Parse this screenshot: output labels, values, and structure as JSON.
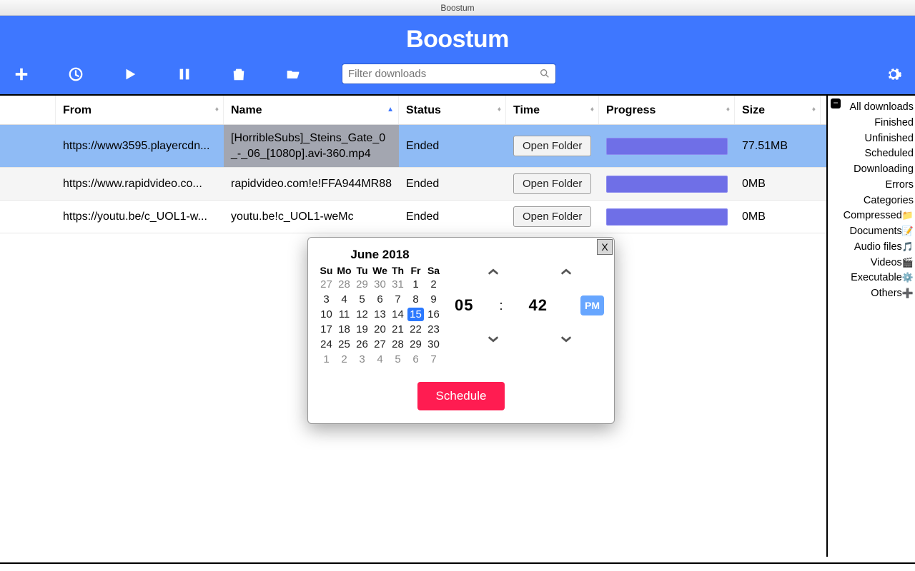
{
  "window_title": "Boostum",
  "app_title": "Boostum",
  "search": {
    "placeholder": "Filter downloads"
  },
  "columns": {
    "from": "From",
    "name": "Name",
    "status": "Status",
    "time": "Time",
    "progress": "Progress",
    "size": "Size"
  },
  "open_folder_label": "Open Folder",
  "rows": [
    {
      "from": "https://www3595.playercdn...",
      "name": "[HorribleSubs]_Steins_Gate_0_-_06_[1080p].avi-360.mp4",
      "status": "Ended",
      "size": "77.51MB"
    },
    {
      "from": "https://www.rapidvideo.co...",
      "name": "rapidvideo.com!e!FFA944MR88",
      "status": "Ended",
      "size": "0MB"
    },
    {
      "from": "https://youtu.be/c_UOL1-w...",
      "name": "youtu.be!c_UOL1-weMc",
      "status": "Ended",
      "size": "0MB"
    }
  ],
  "sidebar": {
    "items": [
      "All downloads",
      "Finished",
      "Unfinished",
      "Scheduled",
      "Downloading",
      "Errors",
      "Categories",
      "Compressed",
      "Documents",
      "Audio files",
      "Videos",
      "Executable",
      "Others"
    ]
  },
  "popup": {
    "close": "X",
    "month_title": "June 2018",
    "weekdays": [
      "Su",
      "Mo",
      "Tu",
      "We",
      "Th",
      "Fr",
      "Sa"
    ],
    "days": [
      {
        "n": "27",
        "o": true
      },
      {
        "n": "28",
        "o": true
      },
      {
        "n": "29",
        "o": true
      },
      {
        "n": "30",
        "o": true
      },
      {
        "n": "31",
        "o": true
      },
      {
        "n": "1"
      },
      {
        "n": "2"
      },
      {
        "n": "3"
      },
      {
        "n": "4"
      },
      {
        "n": "5"
      },
      {
        "n": "6"
      },
      {
        "n": "7"
      },
      {
        "n": "8"
      },
      {
        "n": "9"
      },
      {
        "n": "10"
      },
      {
        "n": "11"
      },
      {
        "n": "12"
      },
      {
        "n": "13"
      },
      {
        "n": "14"
      },
      {
        "n": "15",
        "sel": true
      },
      {
        "n": "16"
      },
      {
        "n": "17"
      },
      {
        "n": "18"
      },
      {
        "n": "19"
      },
      {
        "n": "20"
      },
      {
        "n": "21"
      },
      {
        "n": "22"
      },
      {
        "n": "23"
      },
      {
        "n": "24"
      },
      {
        "n": "25"
      },
      {
        "n": "26"
      },
      {
        "n": "27"
      },
      {
        "n": "28"
      },
      {
        "n": "29"
      },
      {
        "n": "30"
      },
      {
        "n": "1",
        "o": true
      },
      {
        "n": "2",
        "o": true
      },
      {
        "n": "3",
        "o": true
      },
      {
        "n": "4",
        "o": true
      },
      {
        "n": "5",
        "o": true
      },
      {
        "n": "6",
        "o": true
      },
      {
        "n": "7",
        "o": true
      }
    ],
    "hour": "05",
    "minute": "42",
    "colon": ":",
    "ampm": "PM",
    "schedule_label": "Schedule"
  }
}
